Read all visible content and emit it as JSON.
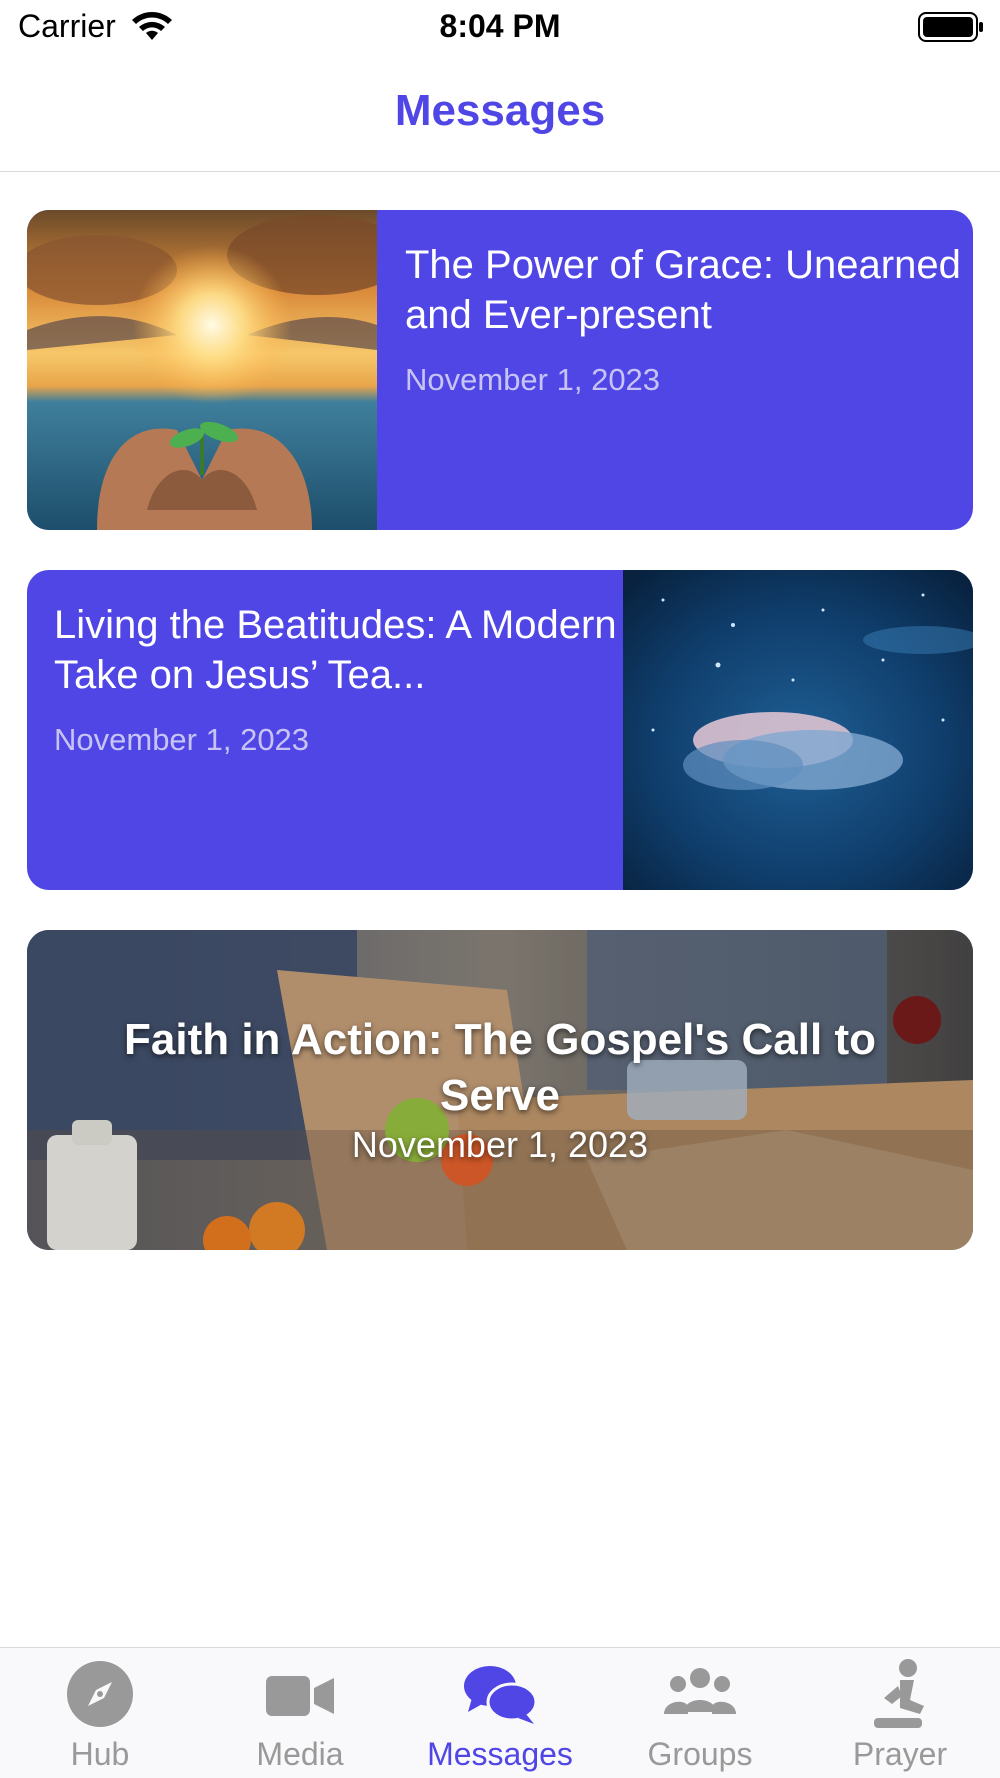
{
  "status_bar": {
    "carrier": "Carrier",
    "time": "8:04 PM"
  },
  "nav": {
    "title": "Messages"
  },
  "messages": [
    {
      "title": "The Power of Grace: Unearned and Ever-present",
      "date": "November 1, 2023"
    },
    {
      "title": "Living the Beatitudes: A Modern Take on Jesus’ Tea...",
      "date": "November 1, 2023"
    },
    {
      "title": "Faith in Action: The Gospel's Call to Serve",
      "date": "November 1, 2023"
    }
  ],
  "tabs": [
    {
      "label": "Hub",
      "icon": "compass-icon",
      "active": false
    },
    {
      "label": "Media",
      "icon": "video-camera-icon",
      "active": false
    },
    {
      "label": "Messages",
      "icon": "chat-bubbles-icon",
      "active": true
    },
    {
      "label": "Groups",
      "icon": "people-icon",
      "active": false
    },
    {
      "label": "Prayer",
      "icon": "praying-person-icon",
      "active": false
    }
  ],
  "colors": {
    "accent": "#4f46e5",
    "inactive_tab": "#999999",
    "card_bg": "#4f46e5"
  }
}
